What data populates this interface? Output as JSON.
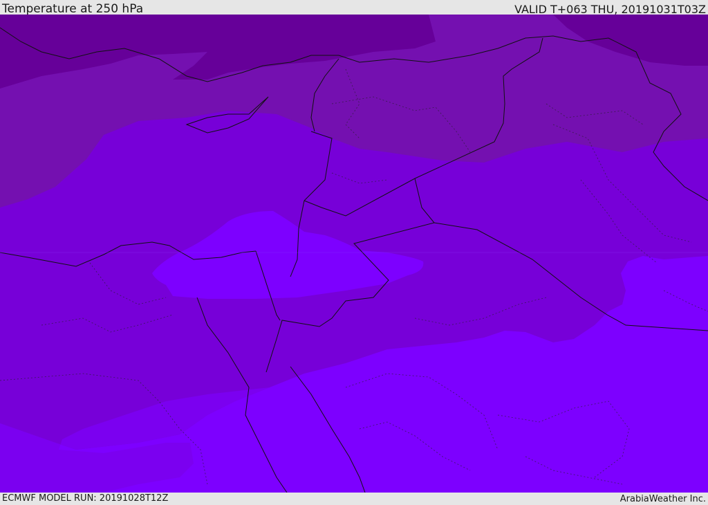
{
  "header": {
    "title": "Temperature at 250 hPa",
    "valid": "VALID T+063 THU, 20191031T03Z"
  },
  "footer": {
    "model_run": "ECMWF MODEL RUN: 20191028T12Z",
    "credit": "ArabiaWeather Inc."
  },
  "map": {
    "field": "temperature",
    "level": "250 hPa",
    "colors": {
      "coldest": "#660099",
      "cold": "#7410b0",
      "mid": "#7700d8",
      "warm": "#7b00f0",
      "warmest": "#7d00ff",
      "borders": "#111111"
    }
  }
}
